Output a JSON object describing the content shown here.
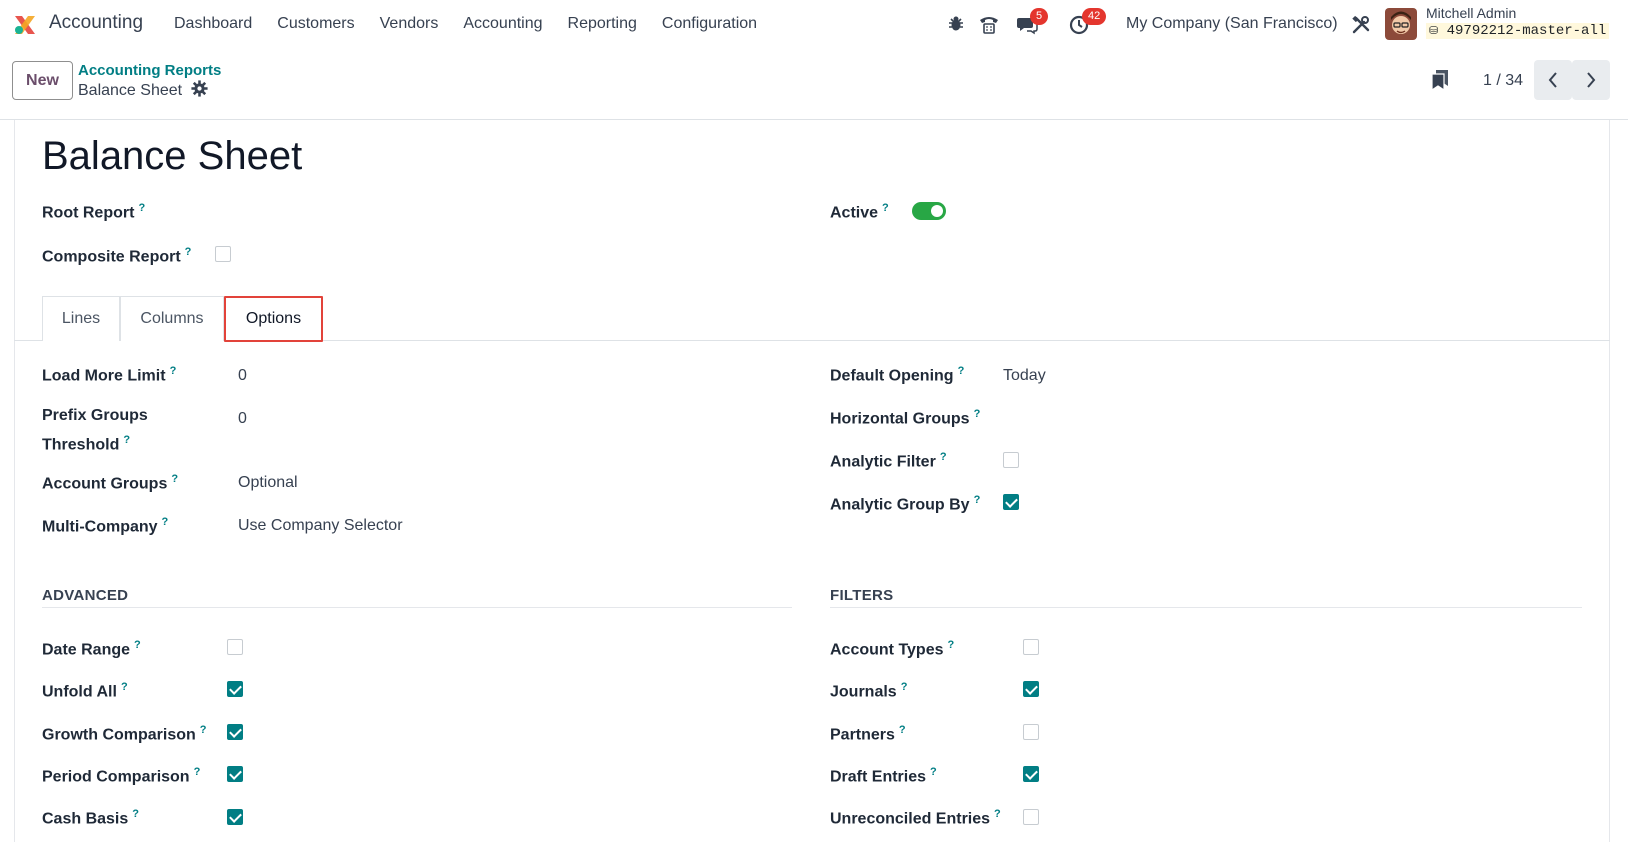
{
  "navbar": {
    "app_name": "Accounting",
    "menu": [
      "Dashboard",
      "Customers",
      "Vendors",
      "Accounting",
      "Reporting",
      "Configuration"
    ],
    "messages_badge": "5",
    "activities_badge": "42",
    "company": "My Company (San Francisco)",
    "user_name": "Mitchell Admin",
    "db_name": "49792212-master-all"
  },
  "control_panel": {
    "new_label": "New",
    "breadcrumb_parent": "Accounting Reports",
    "breadcrumb_current": "Balance Sheet",
    "pager_value": "1 / 34"
  },
  "form": {
    "title": "Balance Sheet",
    "root_report_label": "Root Report",
    "composite_report_label": "Composite Report",
    "composite_report_checked": false,
    "active_label": "Active",
    "active_on": true,
    "help_marker": "?",
    "tabs": [
      {
        "label": "Lines",
        "active": false
      },
      {
        "label": "Columns",
        "active": false
      },
      {
        "label": "Options",
        "active": true
      }
    ],
    "options_left": [
      {
        "label": "Load More Limit",
        "value": "0"
      },
      {
        "label": "Prefix Groups Threshold",
        "value": "0"
      },
      {
        "label": "Account Groups",
        "value": "Optional"
      },
      {
        "label": "Multi-Company",
        "value": "Use Company Selector"
      }
    ],
    "options_right": [
      {
        "label": "Default Opening",
        "value": "Today"
      },
      {
        "label": "Horizontal Groups",
        "value": ""
      },
      {
        "label": "Analytic Filter",
        "checked": false
      },
      {
        "label": "Analytic Group By",
        "checked": true
      }
    ],
    "advanced": {
      "title": "ADVANCED",
      "items": [
        {
          "label": "Date Range",
          "checked": false
        },
        {
          "label": "Unfold All",
          "checked": true
        },
        {
          "label": "Growth Comparison",
          "checked": true
        },
        {
          "label": "Period Comparison",
          "checked": true
        },
        {
          "label": "Cash Basis",
          "checked": true
        }
      ]
    },
    "filters": {
      "title": "FILTERS",
      "items": [
        {
          "label": "Account Types",
          "checked": false
        },
        {
          "label": "Journals",
          "checked": true
        },
        {
          "label": "Partners",
          "checked": false
        },
        {
          "label": "Draft Entries",
          "checked": true
        },
        {
          "label": "Unreconciled Entries",
          "checked": false
        }
      ]
    }
  },
  "colors": {
    "accent": "#017e84",
    "toggle_on": "#28a745",
    "badge": "#e4362e",
    "tab_highlight": "#e2433a"
  }
}
